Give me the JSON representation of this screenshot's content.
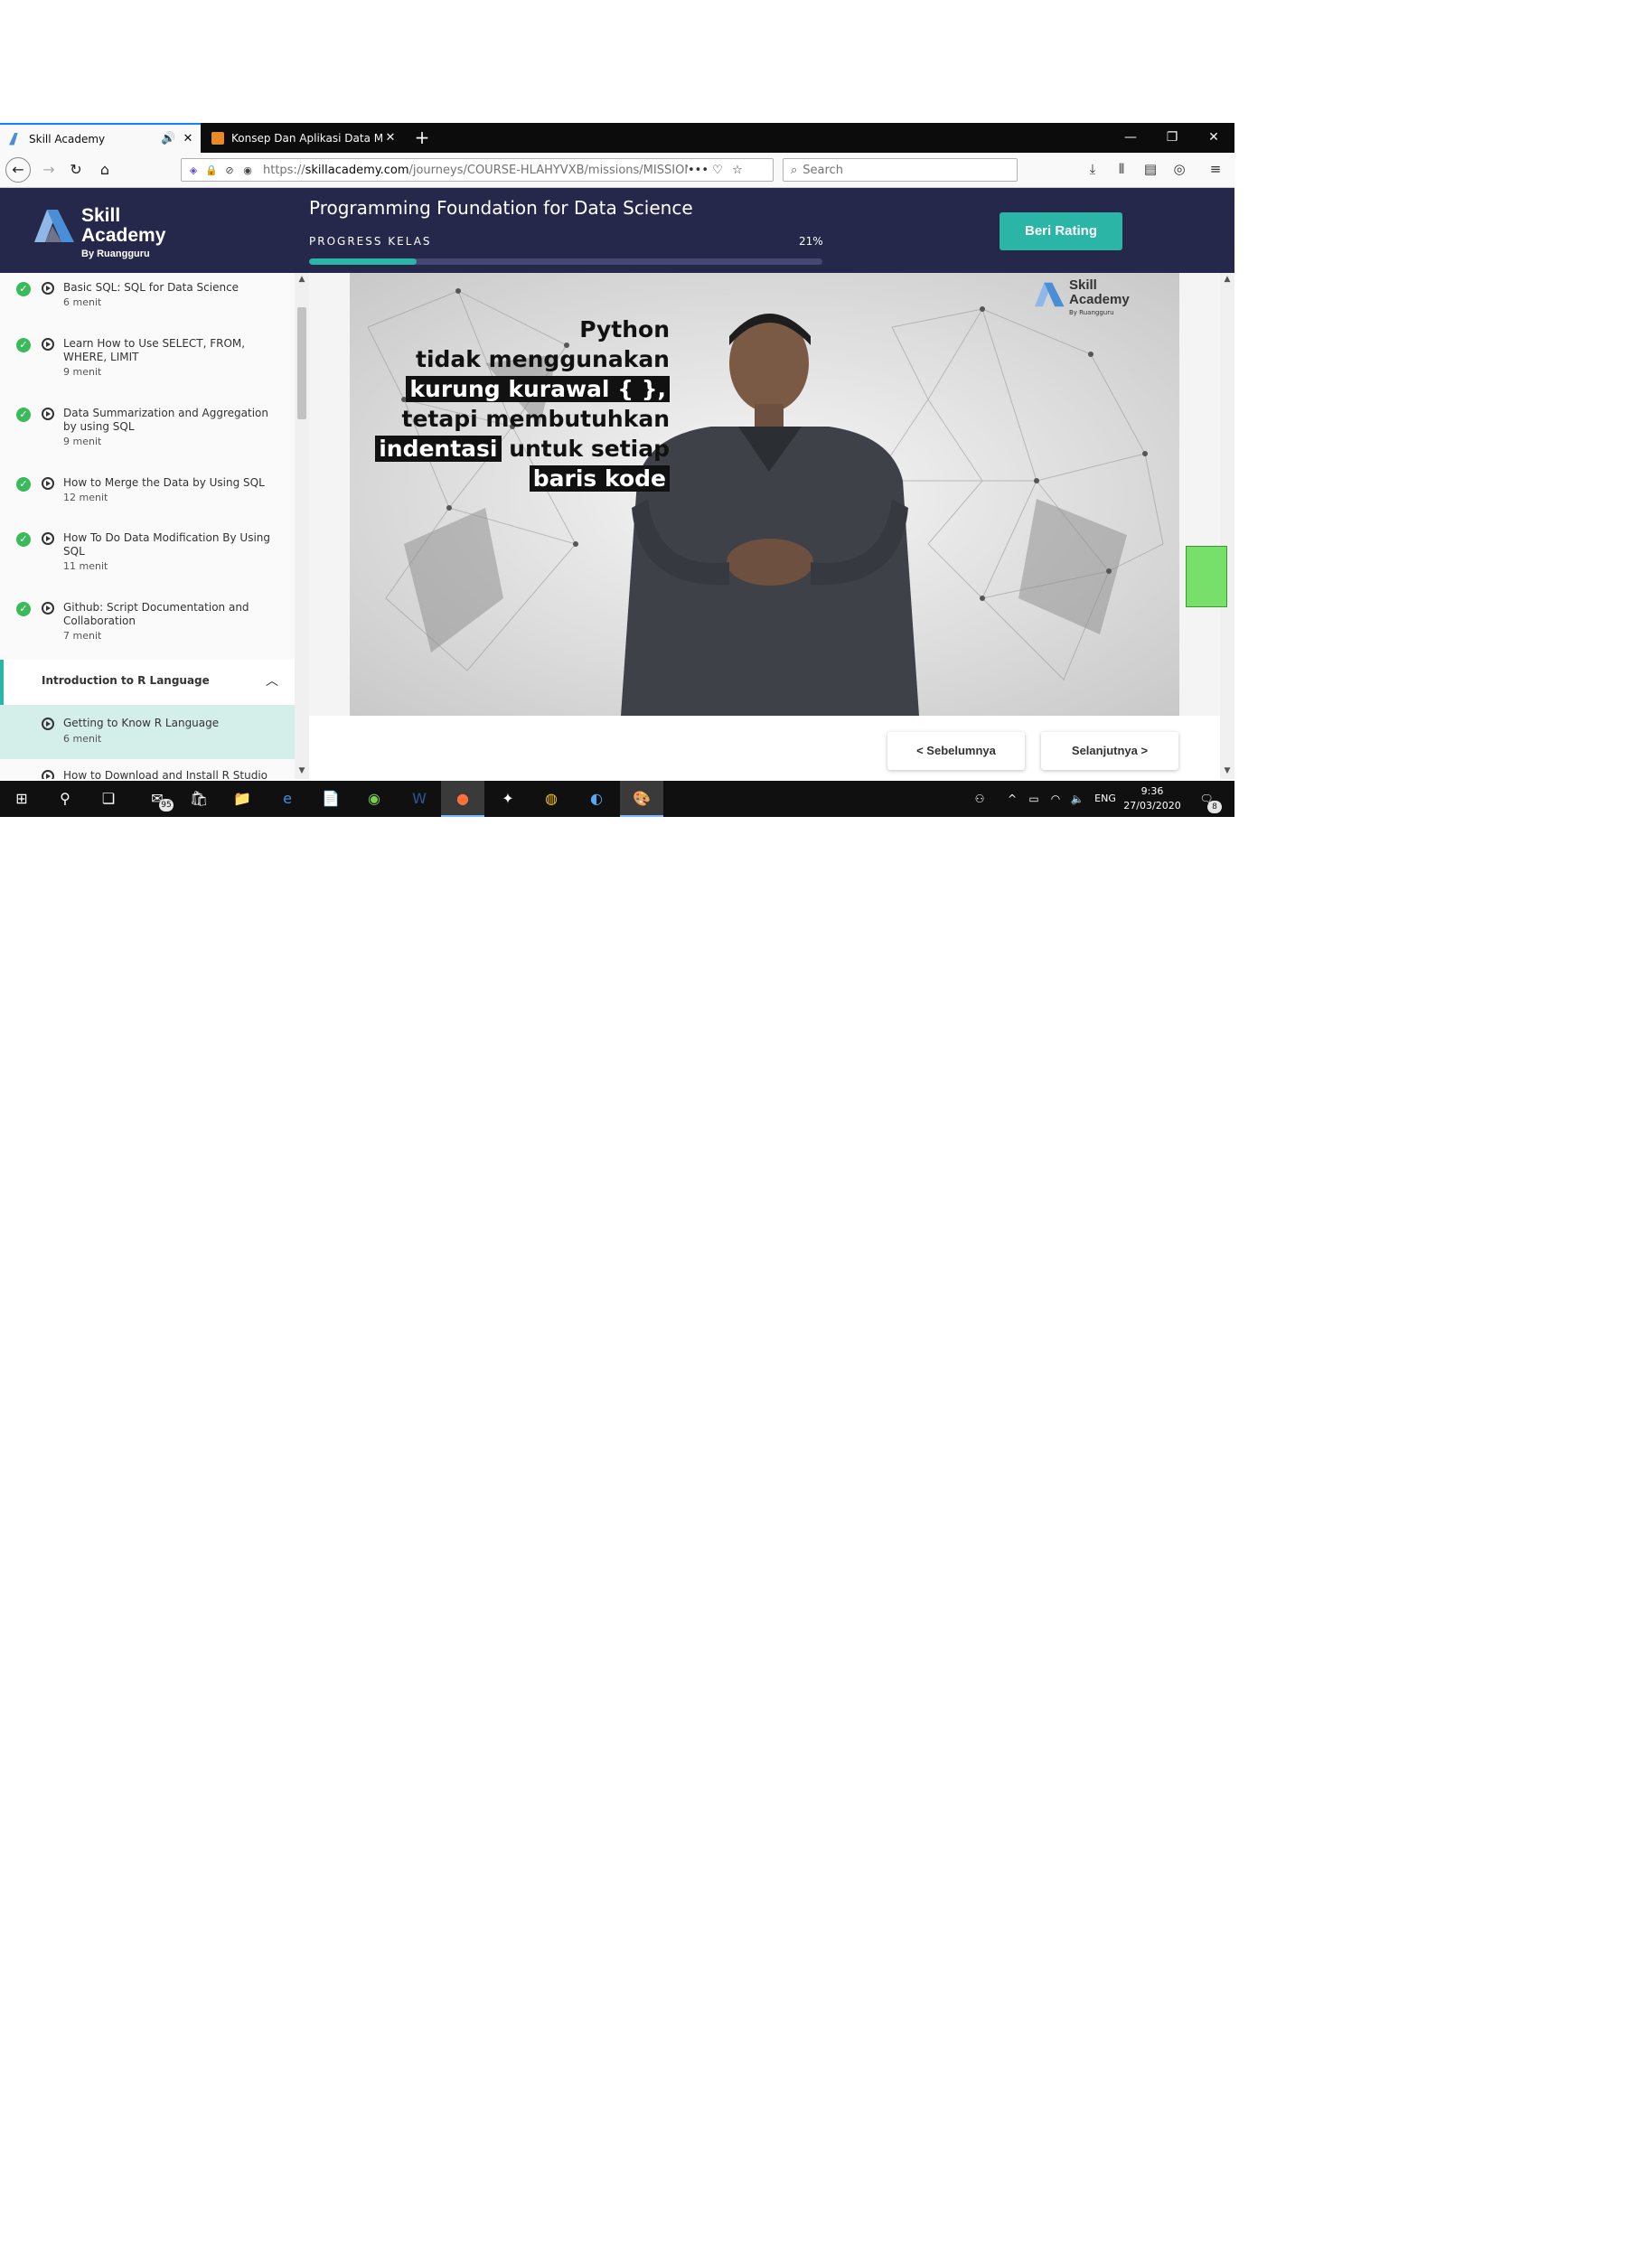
{
  "browser": {
    "tabs": [
      {
        "label": "Skill Academy",
        "favicon_color": "#4a8fd6"
      },
      {
        "label": "Konsep Dan Aplikasi Data Minin",
        "favicon_color": "#e98a2a"
      }
    ],
    "url_domain": "skillacademy.com",
    "url_prefix": "https://",
    "url_path": "/journeys/COURSE-HLAHYVXB/missions/MISSION-T",
    "search_placeholder": "Search"
  },
  "site": {
    "brand_line1": "Skill",
    "brand_line2": "Academy",
    "brand_by": "By Ruangguru",
    "course_title": "Programming Foundation for Data Science",
    "progress_label": "PROGRESS KELAS",
    "progress_percent_text": "21%",
    "progress_value": 0.21,
    "rating_button": "Beri Rating",
    "accent_color": "#2bb5a6",
    "header_color": "#26284b"
  },
  "sidebar": {
    "lessons": [
      {
        "title": "Basic SQL: SQL for Data Science",
        "duration": "6 menit"
      },
      {
        "title": "Learn How to Use SELECT, FROM, WHERE, LIMIT",
        "duration": "9 menit"
      },
      {
        "title": "Data Summarization and Aggregation by using SQL",
        "duration": "9 menit"
      },
      {
        "title": "How to Merge the Data by Using SQL",
        "duration": "12 menit"
      },
      {
        "title": "How To Do Data Modification By Using SQL",
        "duration": "11 menit"
      },
      {
        "title": "Github: Script Documentation and Collaboration",
        "duration": "7 menit"
      }
    ],
    "section_title": "Introduction to R Language",
    "current_lesson": {
      "title": "Getting to Know R Language",
      "duration": "6 menit"
    },
    "next_lesson_partial": "How to Download and Install R Studio"
  },
  "video": {
    "caption_line1": "Python",
    "caption_line2": "tidak menggunakan",
    "caption_line3": "kurung kurawal { },",
    "caption_line4": "tetapi membutuhkan",
    "caption_line5a": "indentasi",
    "caption_line5b": " untuk setiap",
    "caption_line6": "baris kode",
    "logo_line1": "Skill",
    "logo_line2": "Academy",
    "logo_by": "By Ruangguru"
  },
  "navigation": {
    "prev": "<  Sebelumnya",
    "next": "Selanjutnya  >"
  },
  "taskbar": {
    "mail_badge": "95",
    "language": "ENG",
    "time": "9:36",
    "date": "27/03/2020",
    "notif_badge": "8"
  }
}
